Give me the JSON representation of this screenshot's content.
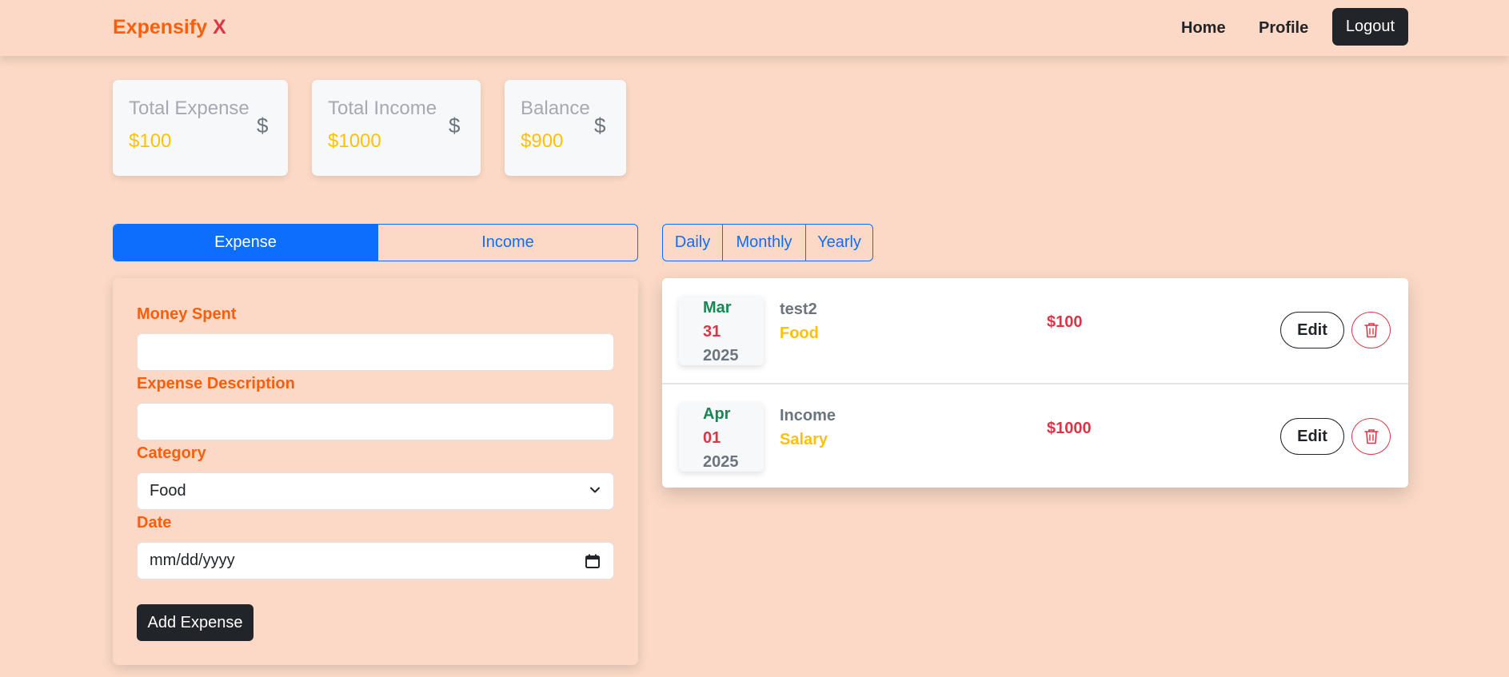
{
  "navbar": {
    "brand_main": "Expensify",
    "brand_accent": "X",
    "links": [
      "Home",
      "Profile"
    ],
    "logout_label": "Logout"
  },
  "stats": [
    {
      "title": "Total Expense",
      "value": "$100",
      "icon": "$"
    },
    {
      "title": "Total Income",
      "value": "$1000",
      "icon": "$"
    },
    {
      "title": "Balance",
      "value": "$900",
      "icon": "$"
    }
  ],
  "type_toggle": {
    "options": [
      "Expense",
      "Income"
    ],
    "active": "Expense"
  },
  "period_toggle": {
    "options": [
      "Daily",
      "Monthly",
      "Yearly"
    ]
  },
  "form": {
    "money_label": "Money Spent",
    "money_value": "",
    "desc_label": "Expense Description",
    "desc_value": "",
    "category_label": "Category",
    "category_value": "Food",
    "date_label": "Date",
    "date_placeholder": "mm/dd/yyyy",
    "submit_label": "Add Expense"
  },
  "transactions": [
    {
      "month": "Mar",
      "day": "31",
      "year": "2025",
      "description": "test2",
      "category": "Food",
      "amount": "$100",
      "edit_label": "Edit"
    },
    {
      "month": "Apr",
      "day": "01",
      "year": "2025",
      "description": "Income",
      "category": "Salary",
      "amount": "$1000",
      "edit_label": "Edit"
    }
  ],
  "colors": {
    "background": "#fbd9c6",
    "brand": "#fd5e0a",
    "accent_blue": "#0d6efd",
    "danger": "#dc3545",
    "warning": "#ffc107",
    "success": "#198754",
    "dark": "#212529"
  },
  "icons": {
    "delete": "trash-icon",
    "category_select": "chevron-down-icon",
    "date_picker": "calendar-icon"
  }
}
